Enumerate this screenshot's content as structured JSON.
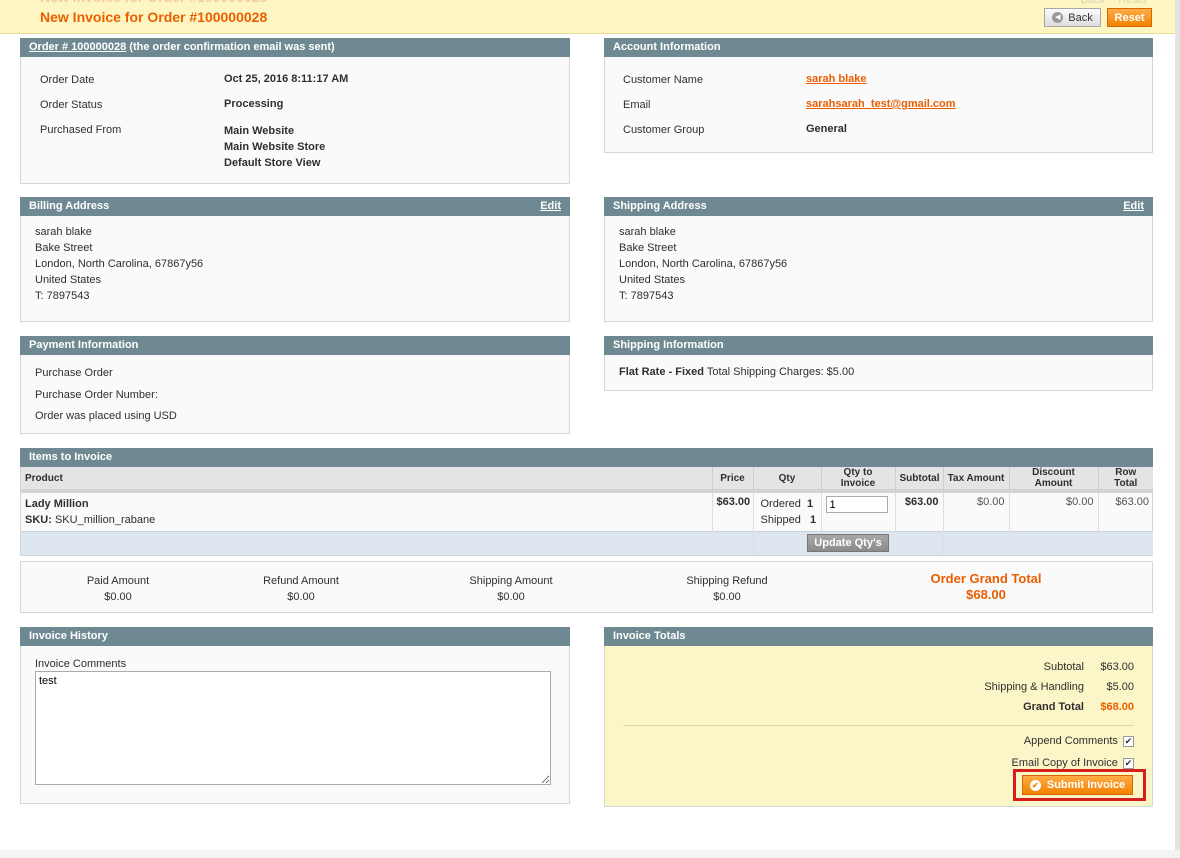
{
  "header": {
    "title": "New Invoice for Order #100000028",
    "back_label": "Back",
    "reset_label": "Reset"
  },
  "order": {
    "link": "Order # 100000028",
    "note": "(the order confirmation email was sent)",
    "date_label": "Order Date",
    "date": "Oct 25, 2016 8:11:17 AM",
    "status_label": "Order Status",
    "status": "Processing",
    "from_label": "Purchased From",
    "from": [
      "Main Website",
      "Main Website Store",
      "Default Store View"
    ]
  },
  "account": {
    "title": "Account Information",
    "name_label": "Customer Name",
    "name": "sarah blake",
    "email_label": "Email",
    "email": "sarahsarah_test@gmail.com",
    "group_label": "Customer Group",
    "group": "General"
  },
  "billing": {
    "title": "Billing Address",
    "edit": "Edit",
    "lines": [
      "sarah blake",
      "Bake Street",
      "London, North Carolina, 67867y56",
      "United States",
      "T: 7897543"
    ]
  },
  "shipping": {
    "title": "Shipping Address",
    "edit": "Edit",
    "lines": [
      "sarah blake",
      "Bake Street",
      "London, North Carolina, 67867y56",
      "United States",
      "T: 7897543"
    ]
  },
  "payment": {
    "title": "Payment Information",
    "lines": [
      "Purchase Order",
      "Purchase Order Number:",
      "Order was placed using USD"
    ]
  },
  "shipping_info": {
    "title": "Shipping Information",
    "method": "Flat Rate - Fixed",
    "charges": "Total Shipping Charges: $5.00"
  },
  "items": {
    "title": "Items to Invoice",
    "headers": [
      "Product",
      "Price",
      "Qty",
      "Qty to Invoice",
      "Subtotal",
      "Tax Amount",
      "Discount Amount",
      "Row Total"
    ],
    "row": {
      "name": "Lady Million",
      "sku_label": "SKU:",
      "sku": "SKU_million_rabane",
      "price": "$63.00",
      "ordered_label": "Ordered",
      "ordered": "1",
      "shipped_label": "Shipped",
      "shipped": "1",
      "qty_to_invoice": "1",
      "subtotal": "$63.00",
      "tax": "$0.00",
      "discount": "$0.00",
      "row_total": "$63.00"
    },
    "update_label": "Update Qty's"
  },
  "summary": {
    "paid_label": "Paid Amount",
    "paid": "$0.00",
    "refund_label": "Refund Amount",
    "refund": "$0.00",
    "ship_label": "Shipping Amount",
    "ship": "$0.00",
    "ship_refund_label": "Shipping Refund",
    "ship_refund": "$0.00",
    "grand_label": "Order Grand Total",
    "grand": "$68.00"
  },
  "history": {
    "title": "Invoice History",
    "comments_label": "Invoice Comments",
    "comment": "test"
  },
  "totals": {
    "title": "Invoice Totals",
    "subtotal_label": "Subtotal",
    "subtotal": "$63.00",
    "shipping_label": "Shipping & Handling",
    "shipping": "$5.00",
    "grand_label": "Grand Total",
    "grand": "$68.00",
    "append_label": "Append Comments",
    "email_label": "Email Copy of Invoice",
    "submit_label": "Submit Invoice"
  },
  "colors": {
    "accent": "#eb5e00",
    "box_header": "#6f8992",
    "header_bg": "#fdf6c2",
    "highlight": "#d81d1d"
  }
}
